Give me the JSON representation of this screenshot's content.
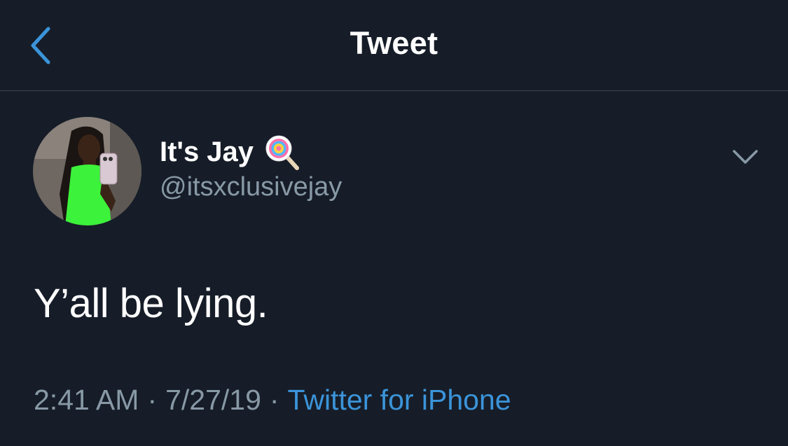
{
  "header": {
    "title": "Tweet",
    "back_icon": "chevron-left-icon"
  },
  "tweet": {
    "author": {
      "display_name": "It's Jay",
      "emoji": "lollipop",
      "handle": "@itsxclusivejay"
    },
    "text": "Y’all be lying.",
    "time": "2:41 AM",
    "date": "7/27/19",
    "separator": "·",
    "source": "Twitter for iPhone"
  },
  "colors": {
    "background": "#161d28",
    "accent": "#3b94d9",
    "secondary_text": "#8899a6",
    "divider": "#3b4450"
  }
}
